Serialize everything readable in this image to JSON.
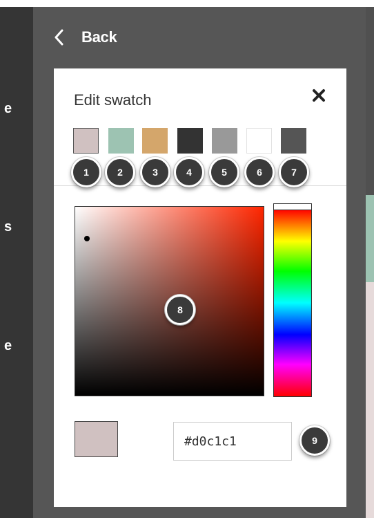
{
  "sidebar": {
    "fragments": [
      "e",
      "s",
      "e"
    ]
  },
  "nav": {
    "back_label": "Back",
    "back_icon": "chevron-left-icon"
  },
  "dialog": {
    "title": "Edit swatch",
    "close_icon": "close-x-icon",
    "swatches": [
      {
        "color": "#d0c1c1",
        "badge": "1",
        "selected": true
      },
      {
        "color": "#9dc3b2",
        "badge": "2",
        "selected": false
      },
      {
        "color": "#d4a66b",
        "badge": "3",
        "selected": false
      },
      {
        "color": "#333333",
        "badge": "4",
        "selected": false
      },
      {
        "color": "#999999",
        "badge": "5",
        "selected": false
      },
      {
        "color": "#ffffff",
        "badge": "6",
        "selected": false
      },
      {
        "color": "#555555",
        "badge": "7",
        "selected": false
      }
    ],
    "picker": {
      "hue_color": "#ff2600",
      "sv_badge": "8"
    },
    "preview_color": "#d0c1c1",
    "hex_value": "#d0c1c1",
    "hex_badge": "9"
  },
  "colors": {
    "dark_panel": "#565656",
    "left_strip": "#353535",
    "accent_green": "#9dc3b2",
    "badge_bg": "#3a3a3a"
  }
}
